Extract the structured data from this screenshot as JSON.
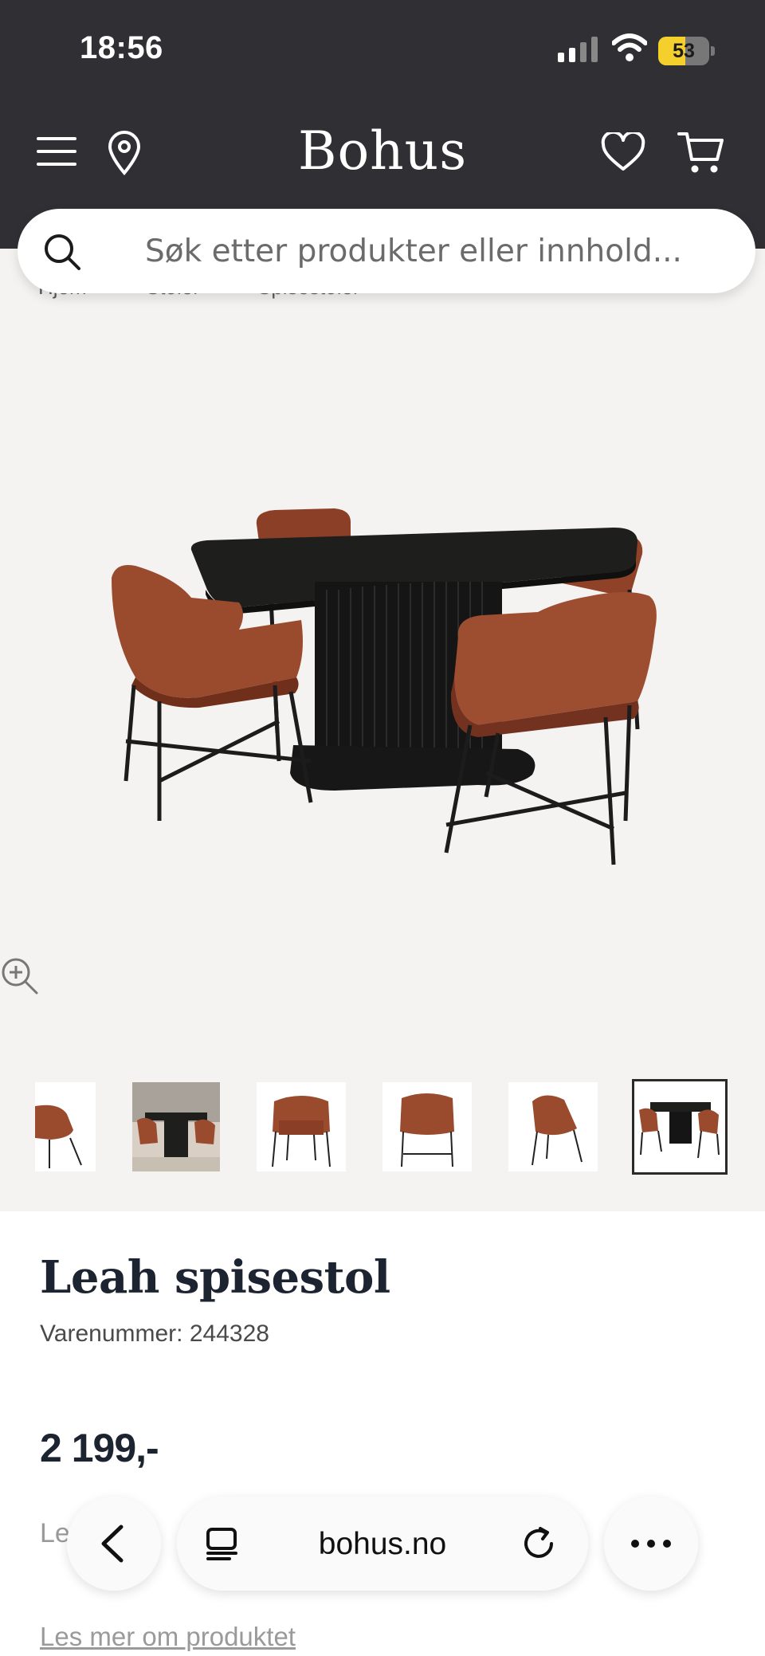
{
  "status_bar": {
    "time": "18:56",
    "battery_level": "53",
    "battery_fraction": 0.53
  },
  "header": {
    "logo": "Bohus"
  },
  "search": {
    "placeholder": "Søk etter produkter eller innhold..."
  },
  "breadcrumb": {
    "items": [
      "Hjem",
      "Stoler",
      "Spisestoler"
    ]
  },
  "gallery": {
    "thumbnail_count": 6,
    "active_index": 5
  },
  "product": {
    "title": "Leah spisestol",
    "sku_label": "Varenummer: 244328",
    "price": "2 199,-",
    "description_partial": "Le",
    "read_more": "Les mer om produktet"
  },
  "browser": {
    "url": "bohus.no"
  },
  "colors": {
    "header_bg": "#303034",
    "chair": "#9a4b2e",
    "table": "#1e1f1d",
    "battery": "#f5cf2c"
  }
}
